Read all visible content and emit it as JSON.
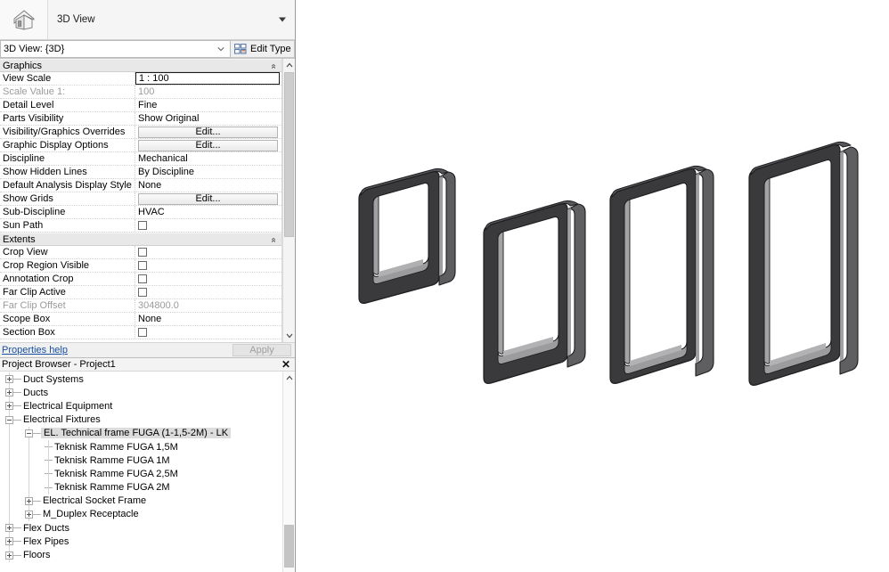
{
  "app": {
    "type_selector": {
      "icon": "house-icon",
      "name": "3D View",
      "dropdown_icon": "caret-down-icon"
    },
    "instance_selector": {
      "value": "3D View: {3D}",
      "dropdown_icon": "chevron-down-icon",
      "edit_type_label": "Edit Type",
      "edit_type_icon": "edit-type-grid-icon"
    }
  },
  "properties": {
    "groups": [
      {
        "name": "Graphics",
        "collapse_icon": "double-chevron-up-icon",
        "rows": [
          {
            "name": "View Scale",
            "value": "1 : 100",
            "kind": "text-active"
          },
          {
            "name": "Scale Value    1:",
            "value": "100",
            "kind": "text",
            "disabled": true
          },
          {
            "name": "Detail Level",
            "value": "Fine",
            "kind": "text"
          },
          {
            "name": "Parts Visibility",
            "value": "Show Original",
            "kind": "text"
          },
          {
            "name": "Visibility/Graphics Overrides",
            "value": "Edit...",
            "kind": "button"
          },
          {
            "name": "Graphic Display Options",
            "value": "Edit...",
            "kind": "button"
          },
          {
            "name": "Discipline",
            "value": "Mechanical",
            "kind": "text"
          },
          {
            "name": "Show Hidden Lines",
            "value": "By Discipline",
            "kind": "text"
          },
          {
            "name": "Default Analysis Display Style",
            "value": "None",
            "kind": "text"
          },
          {
            "name": "Show Grids",
            "value": "Edit...",
            "kind": "button"
          },
          {
            "name": "Sub-Discipline",
            "value": "HVAC",
            "kind": "text"
          },
          {
            "name": "Sun Path",
            "value": "",
            "kind": "checkbox",
            "checked": false
          }
        ]
      },
      {
        "name": "Extents",
        "collapse_icon": "double-chevron-up-icon",
        "rows": [
          {
            "name": "Crop View",
            "value": "",
            "kind": "checkbox",
            "checked": false
          },
          {
            "name": "Crop Region Visible",
            "value": "",
            "kind": "checkbox",
            "checked": false
          },
          {
            "name": "Annotation Crop",
            "value": "",
            "kind": "checkbox",
            "checked": false
          },
          {
            "name": "Far Clip Active",
            "value": "",
            "kind": "checkbox",
            "checked": false
          },
          {
            "name": "Far Clip Offset",
            "value": "304800.0",
            "kind": "text",
            "disabled": true
          },
          {
            "name": "Scope Box",
            "value": "None",
            "kind": "text"
          },
          {
            "name": "Section Box",
            "value": "",
            "kind": "checkbox",
            "checked": false
          }
        ]
      }
    ],
    "footer": {
      "help_link": "Properties help",
      "apply_button": "Apply"
    },
    "scrollbar": {
      "up_icon": "chevron-up-icon",
      "down_icon": "chevron-down-icon"
    }
  },
  "project_browser": {
    "title": "Project Browser - Project1",
    "close_icon": "close-icon",
    "scroll_up_icon": "chevron-up-icon",
    "tree": [
      {
        "label": "Duct Systems",
        "depth": 1,
        "expander": "plus",
        "selected": false
      },
      {
        "label": "Ducts",
        "depth": 1,
        "expander": "plus",
        "selected": false
      },
      {
        "label": "Electrical Equipment",
        "depth": 1,
        "expander": "plus",
        "selected": false
      },
      {
        "label": "Electrical Fixtures",
        "depth": 1,
        "expander": "minus",
        "selected": false
      },
      {
        "label": "EL. Technical frame FUGA (1-1,5-2M) - LK",
        "depth": 2,
        "expander": "minus",
        "selected": true
      },
      {
        "label": "Teknisk Ramme FUGA 1,5M",
        "depth": 3,
        "expander": "none",
        "selected": false
      },
      {
        "label": "Teknisk Ramme FUGA 1M",
        "depth": 3,
        "expander": "none",
        "selected": false
      },
      {
        "label": "Teknisk Ramme FUGA 2,5M",
        "depth": 3,
        "expander": "none",
        "selected": false
      },
      {
        "label": "Teknisk Ramme FUGA 2M",
        "depth": 3,
        "expander": "none",
        "selected": false
      },
      {
        "label": "Electrical Socket Frame",
        "depth": 2,
        "expander": "plus",
        "selected": false
      },
      {
        "label": "M_Duplex Receptacle",
        "depth": 2,
        "expander": "plus",
        "selected": false
      },
      {
        "label": "Flex Ducts",
        "depth": 1,
        "expander": "plus",
        "selected": false
      },
      {
        "label": "Flex Pipes",
        "depth": 1,
        "expander": "plus",
        "selected": false
      },
      {
        "label": "Floors",
        "depth": 1,
        "expander": "plus",
        "selected": false
      }
    ]
  },
  "viewport": {
    "name": "3d-view-canvas",
    "background": "#ffffff",
    "frame_color_dark": "#3a3a3c",
    "frame_color_mid": "#6f6f72",
    "frame_color_light": "#b4b4b6",
    "frame_edge": "#1d1d1f",
    "models": [
      {
        "name": "Teknisk Ramme FUGA 1M",
        "index": 1
      },
      {
        "name": "Teknisk Ramme FUGA 1,5M",
        "index": 2
      },
      {
        "name": "Teknisk Ramme FUGA 2M",
        "index": 3
      },
      {
        "name": "Teknisk Ramme FUGA 2,5M",
        "index": 4
      }
    ]
  }
}
